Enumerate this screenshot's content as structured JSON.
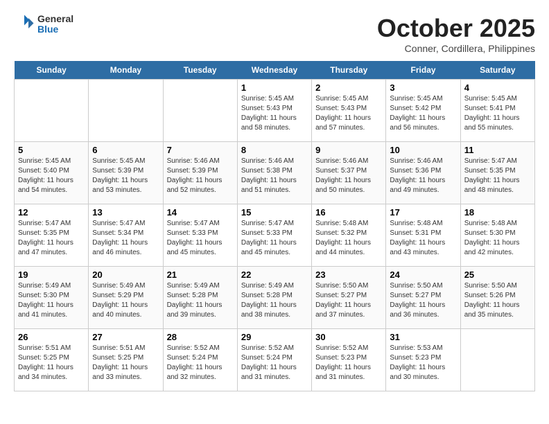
{
  "header": {
    "logo_general": "General",
    "logo_blue": "Blue",
    "title": "October 2025",
    "subtitle": "Conner, Cordillera, Philippines"
  },
  "days_of_week": [
    "Sunday",
    "Monday",
    "Tuesday",
    "Wednesday",
    "Thursday",
    "Friday",
    "Saturday"
  ],
  "weeks": [
    [
      {
        "date": "",
        "sunrise": "",
        "sunset": "",
        "daylight": ""
      },
      {
        "date": "",
        "sunrise": "",
        "sunset": "",
        "daylight": ""
      },
      {
        "date": "",
        "sunrise": "",
        "sunset": "",
        "daylight": ""
      },
      {
        "date": "1",
        "sunrise": "Sunrise: 5:45 AM",
        "sunset": "Sunset: 5:43 PM",
        "daylight": "Daylight: 11 hours and 58 minutes."
      },
      {
        "date": "2",
        "sunrise": "Sunrise: 5:45 AM",
        "sunset": "Sunset: 5:43 PM",
        "daylight": "Daylight: 11 hours and 57 minutes."
      },
      {
        "date": "3",
        "sunrise": "Sunrise: 5:45 AM",
        "sunset": "Sunset: 5:42 PM",
        "daylight": "Daylight: 11 hours and 56 minutes."
      },
      {
        "date": "4",
        "sunrise": "Sunrise: 5:45 AM",
        "sunset": "Sunset: 5:41 PM",
        "daylight": "Daylight: 11 hours and 55 minutes."
      }
    ],
    [
      {
        "date": "5",
        "sunrise": "Sunrise: 5:45 AM",
        "sunset": "Sunset: 5:40 PM",
        "daylight": "Daylight: 11 hours and 54 minutes."
      },
      {
        "date": "6",
        "sunrise": "Sunrise: 5:45 AM",
        "sunset": "Sunset: 5:39 PM",
        "daylight": "Daylight: 11 hours and 53 minutes."
      },
      {
        "date": "7",
        "sunrise": "Sunrise: 5:46 AM",
        "sunset": "Sunset: 5:39 PM",
        "daylight": "Daylight: 11 hours and 52 minutes."
      },
      {
        "date": "8",
        "sunrise": "Sunrise: 5:46 AM",
        "sunset": "Sunset: 5:38 PM",
        "daylight": "Daylight: 11 hours and 51 minutes."
      },
      {
        "date": "9",
        "sunrise": "Sunrise: 5:46 AM",
        "sunset": "Sunset: 5:37 PM",
        "daylight": "Daylight: 11 hours and 50 minutes."
      },
      {
        "date": "10",
        "sunrise": "Sunrise: 5:46 AM",
        "sunset": "Sunset: 5:36 PM",
        "daylight": "Daylight: 11 hours and 49 minutes."
      },
      {
        "date": "11",
        "sunrise": "Sunrise: 5:47 AM",
        "sunset": "Sunset: 5:35 PM",
        "daylight": "Daylight: 11 hours and 48 minutes."
      }
    ],
    [
      {
        "date": "12",
        "sunrise": "Sunrise: 5:47 AM",
        "sunset": "Sunset: 5:35 PM",
        "daylight": "Daylight: 11 hours and 47 minutes."
      },
      {
        "date": "13",
        "sunrise": "Sunrise: 5:47 AM",
        "sunset": "Sunset: 5:34 PM",
        "daylight": "Daylight: 11 hours and 46 minutes."
      },
      {
        "date": "14",
        "sunrise": "Sunrise: 5:47 AM",
        "sunset": "Sunset: 5:33 PM",
        "daylight": "Daylight: 11 hours and 45 minutes."
      },
      {
        "date": "15",
        "sunrise": "Sunrise: 5:47 AM",
        "sunset": "Sunset: 5:33 PM",
        "daylight": "Daylight: 11 hours and 45 minutes."
      },
      {
        "date": "16",
        "sunrise": "Sunrise: 5:48 AM",
        "sunset": "Sunset: 5:32 PM",
        "daylight": "Daylight: 11 hours and 44 minutes."
      },
      {
        "date": "17",
        "sunrise": "Sunrise: 5:48 AM",
        "sunset": "Sunset: 5:31 PM",
        "daylight": "Daylight: 11 hours and 43 minutes."
      },
      {
        "date": "18",
        "sunrise": "Sunrise: 5:48 AM",
        "sunset": "Sunset: 5:30 PM",
        "daylight": "Daylight: 11 hours and 42 minutes."
      }
    ],
    [
      {
        "date": "19",
        "sunrise": "Sunrise: 5:49 AM",
        "sunset": "Sunset: 5:30 PM",
        "daylight": "Daylight: 11 hours and 41 minutes."
      },
      {
        "date": "20",
        "sunrise": "Sunrise: 5:49 AM",
        "sunset": "Sunset: 5:29 PM",
        "daylight": "Daylight: 11 hours and 40 minutes."
      },
      {
        "date": "21",
        "sunrise": "Sunrise: 5:49 AM",
        "sunset": "Sunset: 5:28 PM",
        "daylight": "Daylight: 11 hours and 39 minutes."
      },
      {
        "date": "22",
        "sunrise": "Sunrise: 5:49 AM",
        "sunset": "Sunset: 5:28 PM",
        "daylight": "Daylight: 11 hours and 38 minutes."
      },
      {
        "date": "23",
        "sunrise": "Sunrise: 5:50 AM",
        "sunset": "Sunset: 5:27 PM",
        "daylight": "Daylight: 11 hours and 37 minutes."
      },
      {
        "date": "24",
        "sunrise": "Sunrise: 5:50 AM",
        "sunset": "Sunset: 5:27 PM",
        "daylight": "Daylight: 11 hours and 36 minutes."
      },
      {
        "date": "25",
        "sunrise": "Sunrise: 5:50 AM",
        "sunset": "Sunset: 5:26 PM",
        "daylight": "Daylight: 11 hours and 35 minutes."
      }
    ],
    [
      {
        "date": "26",
        "sunrise": "Sunrise: 5:51 AM",
        "sunset": "Sunset: 5:25 PM",
        "daylight": "Daylight: 11 hours and 34 minutes."
      },
      {
        "date": "27",
        "sunrise": "Sunrise: 5:51 AM",
        "sunset": "Sunset: 5:25 PM",
        "daylight": "Daylight: 11 hours and 33 minutes."
      },
      {
        "date": "28",
        "sunrise": "Sunrise: 5:52 AM",
        "sunset": "Sunset: 5:24 PM",
        "daylight": "Daylight: 11 hours and 32 minutes."
      },
      {
        "date": "29",
        "sunrise": "Sunrise: 5:52 AM",
        "sunset": "Sunset: 5:24 PM",
        "daylight": "Daylight: 11 hours and 31 minutes."
      },
      {
        "date": "30",
        "sunrise": "Sunrise: 5:52 AM",
        "sunset": "Sunset: 5:23 PM",
        "daylight": "Daylight: 11 hours and 31 minutes."
      },
      {
        "date": "31",
        "sunrise": "Sunrise: 5:53 AM",
        "sunset": "Sunset: 5:23 PM",
        "daylight": "Daylight: 11 hours and 30 minutes."
      },
      {
        "date": "",
        "sunrise": "",
        "sunset": "",
        "daylight": ""
      }
    ]
  ]
}
